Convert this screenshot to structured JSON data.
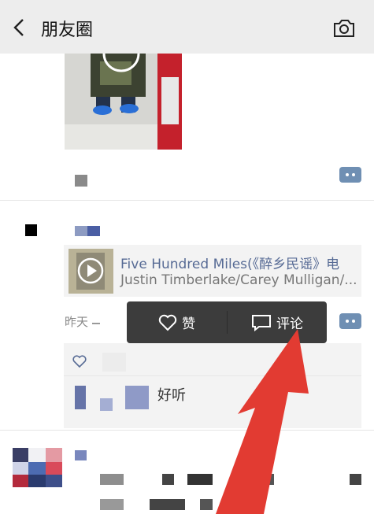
{
  "nav": {
    "title": "朋友圈",
    "back_icon": "chevron-left-icon",
    "camera_icon": "camera-icon"
  },
  "music": {
    "title": "Five Hundred Miles(《醉乡民谣》电",
    "artist": "Justin Timberlake/Carey Mulligan/..."
  },
  "post_time": "昨天",
  "popup": {
    "like_label": "赞",
    "comment_label": "评论"
  },
  "comment": {
    "text": "好听"
  },
  "colors": {
    "link": "#576b95",
    "popup_bg": "#3c3c3c",
    "arrow": "#e23b32"
  }
}
